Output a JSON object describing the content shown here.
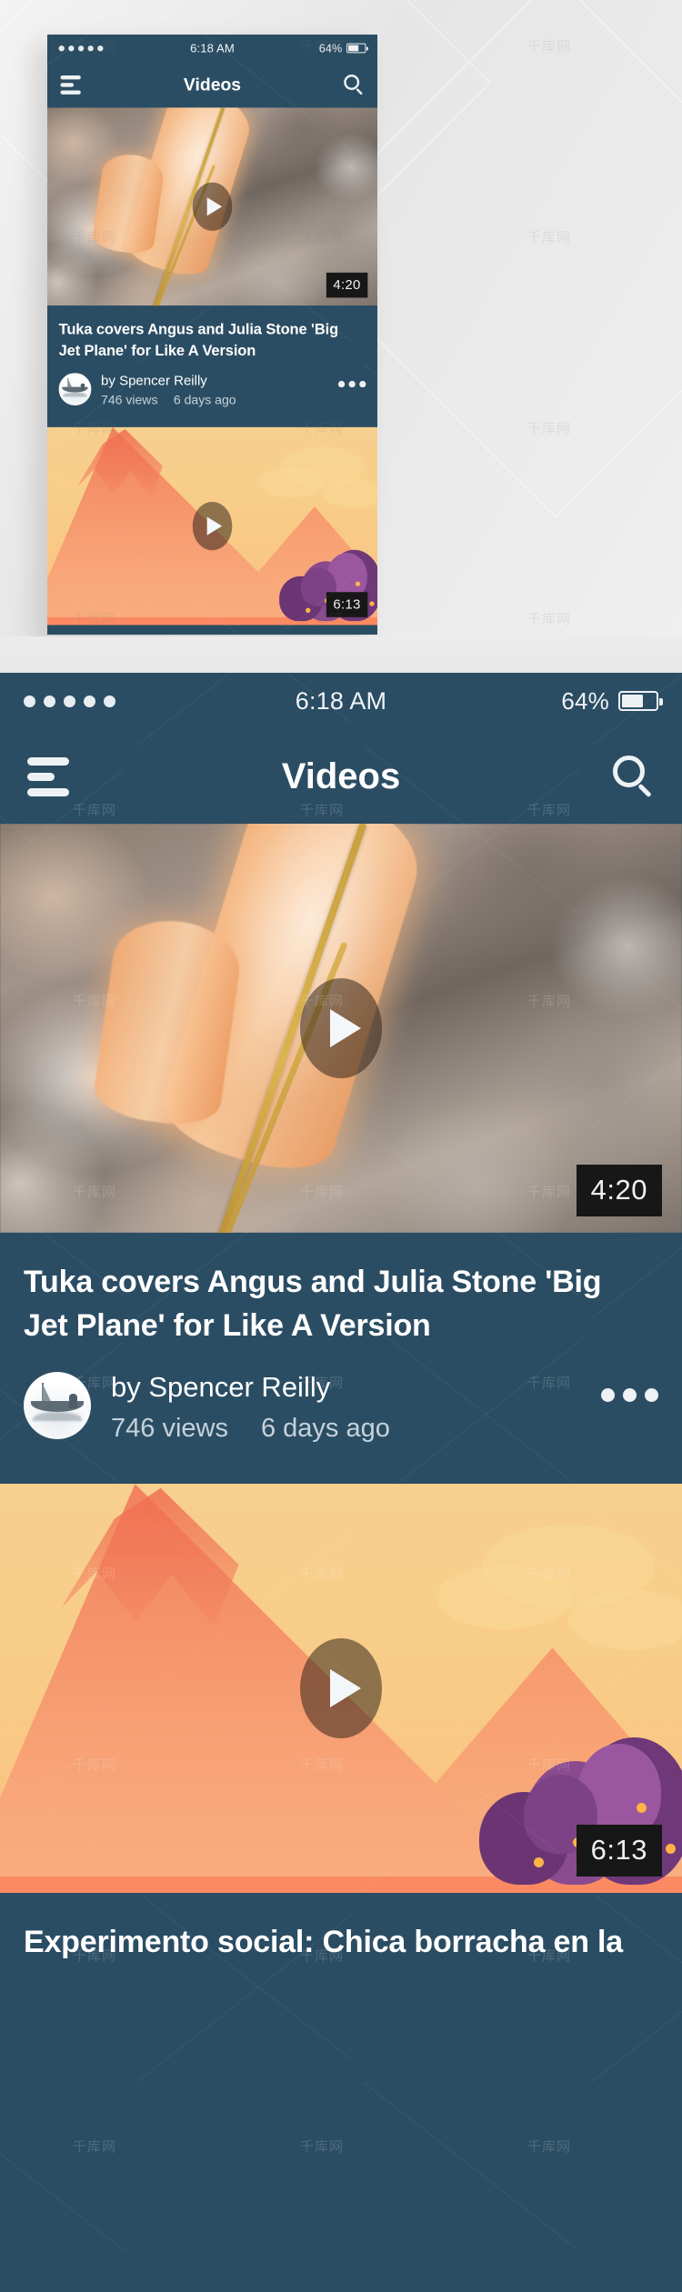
{
  "app": {
    "screen_name": "Videos",
    "accent_navy": "#2b4d63",
    "text_primary": "#ffffff",
    "text_secondary": "#c5d2db"
  },
  "status_bar": {
    "signal_dots": 5,
    "time": "6:18 AM",
    "battery_percent": "64%",
    "battery_level": 64
  },
  "nav": {
    "menu_icon": "hamburger-icon",
    "title": "Videos",
    "search_icon": "search-icon"
  },
  "videos": [
    {
      "thumbnail_kind": "photo-foxtail-grass-bokeh",
      "duration": "4:20",
      "play_icon": "play-icon",
      "title": "Tuka covers Angus and Julia Stone 'Big Jet Plane' for Like A Version",
      "author": "by Spencer Reilly",
      "views": "746 views",
      "published": "6 days ago",
      "avatar_icon": "boat-avatar",
      "more_icon": "kebab-menu-icon"
    },
    {
      "thumbnail_kind": "illustration-orange-mountains-purple-bush",
      "duration": "6:13",
      "play_icon": "play-icon",
      "title": "Experimento social: Chica borracha en la",
      "author": "",
      "views": "",
      "published": "",
      "avatar_icon": "",
      "more_icon": ""
    }
  ]
}
